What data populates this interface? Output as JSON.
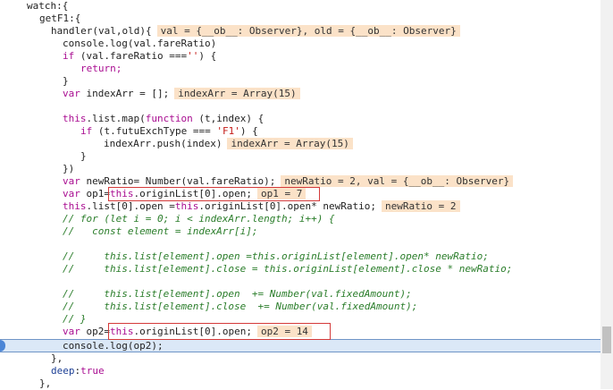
{
  "code": {
    "l01": "watch:{",
    "l02": "getF1:{",
    "l03_code": "handler(val,old){",
    "l03_val": "val = {__ob__: Observer}, old = {__ob__: Observer}",
    "l04": "console.log(val.fareRatio)",
    "l05a": "if",
    "l05b": " (val.fareRatio ===",
    "l05c": "''",
    "l05d": ") {",
    "l06": "return;",
    "l07": "}",
    "l08a": "var",
    "l08b": " indexArr = [];",
    "l08_val": "indexArr = Array(15)",
    "l09a": "this",
    "l09b": ".list.map(",
    "l09c": "function",
    "l09d": " (t,index) {",
    "l10a": "if",
    "l10b": " (t.futuExchType === ",
    "l10c": "'F1'",
    "l10d": ") {",
    "l11": "indexArr.push(index)",
    "l11_val": "indexArr = Array(15)",
    "l12": "}",
    "l13": "})",
    "l14a": "var",
    "l14b": " newRatio= Number(val.fareRatio);",
    "l14_val": "newRatio = 2, val = {__ob__: Observer}",
    "l15a": "var",
    "l15b": " op1=",
    "l15c": "this",
    "l15d": ".originList[0].open;",
    "l15_val": "op1 = 7",
    "l16a": "this",
    "l16b": ".list[0].open =",
    "l16c": "this",
    "l16d": ".originList[0].open* newRatio;",
    "l16_val": "newRatio = 2",
    "l17": "// for (let i = 0; i < indexArr.length; i++) {",
    "l18": "//   const element = indexArr[i];",
    "l19": "//     this.list[element].open =this.originList[element].open* newRatio;",
    "l20": "//     this.list[element].close = this.originList[element].close * newRatio;",
    "l21": "//     this.list[element].open  += Number(val.fixedAmount);",
    "l22": "//     this.list[element].close  += Number(val.fixedAmount);",
    "l23": "// }",
    "l24a": "var",
    "l24b": " op2=",
    "l24c": "this",
    "l24d": ".originList[0].open;",
    "l24_val": "op2 = 14",
    "l25": "console.log(op2);",
    "l26": "},",
    "l27a": "deep",
    "l27b": ":",
    "l27c": "true",
    "l28": "},"
  }
}
